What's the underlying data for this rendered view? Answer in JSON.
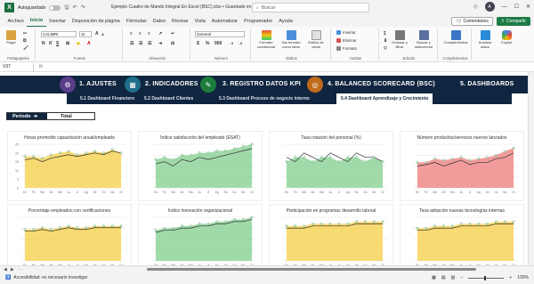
{
  "titlebar": {
    "autosave_label": "Autoguardado",
    "file_title": "Ejemplo Cuadro de Mando Integral En Excel (BSC).xlsx  •  Guardado en…",
    "search_placeholder": "Buscar",
    "avatar_initial": "A"
  },
  "tabs": [
    "Archivo",
    "Inicio",
    "Insertar",
    "Disposición de página",
    "Fórmulas",
    "Datos",
    "Revisar",
    "Vista",
    "Automatizar",
    "Programador",
    "Ayuda"
  ],
  "tab_actions": {
    "comments": "Comentarios",
    "share": "Compartir"
  },
  "ribbon": {
    "paste": "Pegar",
    "font_name": "CALIBRI",
    "font_size": "11",
    "number_format": "General",
    "conditional_format": "Formato condicional",
    "format_table": "Dar formato como tabla",
    "cell_styles": "Estilos de celda",
    "insert": "Insertar",
    "delete": "Eliminar",
    "format": "Formato",
    "sort_filter": "Ordenar y filtrar",
    "find_select": "Buscar y seleccionar",
    "addins": "Complementos",
    "analyze": "Analizar datos",
    "copilot": "Copilot",
    "groups": [
      "Portapapeles",
      "Fuente",
      "Alineación",
      "Número",
      "Estilos",
      "Celdas",
      "Edición",
      "Complementos"
    ]
  },
  "formula": {
    "cell_ref": "V37",
    "fx": "fx"
  },
  "nav": {
    "items": [
      {
        "label": "1. AJUSTES",
        "color": "#5b3d8a",
        "icon": "⚙"
      },
      {
        "label": "2. INDICADORES",
        "color": "#1f6e8c",
        "icon": "▦"
      },
      {
        "label": "3. REGISTRO DATOS KPI",
        "color": "#1c7c3c",
        "icon": "✎"
      },
      {
        "label": "4. BALANCED SCORECARD (BSC)",
        "color": "#c06a1c",
        "icon": "◎"
      },
      {
        "label": "5. DASHBOARDS",
        "color": "#12335a",
        "icon": ""
      }
    ],
    "sub": [
      "5.1 Dashboard Financiero",
      "5.2 Dashboard Clientes",
      "5.3 Dashboard Proceso de negocio interno",
      "5.4 Dashboard Aprendizaje y Crecimiento"
    ]
  },
  "period": {
    "label": "Periodo",
    "arrow": "➔",
    "value": "Total"
  },
  "months": [
    "En",
    "Fe",
    "Ma",
    "Ab",
    "Ma",
    "Ju",
    "Jl",
    "Ag",
    "Se",
    "Oc",
    "No",
    "Di"
  ],
  "chart_data": [
    {
      "type": "area",
      "title": "Horas promedio capacitación anual/empleado",
      "fill": "#f7d35a",
      "ylim": [
        0,
        25
      ],
      "yticks": [
        0,
        5,
        10,
        15,
        20,
        25
      ],
      "series": [
        {
          "values": [
            18,
            18,
            17,
            19,
            20,
            21,
            19,
            20,
            21,
            20,
            22,
            20
          ]
        },
        {
          "values": [
            16,
            17,
            15,
            17,
            18,
            19,
            18,
            19,
            20,
            19,
            21,
            20
          ]
        }
      ]
    },
    {
      "type": "area",
      "title": "Índice satisfacción del empleado (ESAT)",
      "fill": "#8fd39a",
      "ylim": [
        0,
        0.2
      ],
      "yticks": [],
      "series": [
        {
          "values": [
            0.13,
            0.14,
            0.13,
            0.15,
            0.15,
            0.16,
            0.16,
            0.17,
            0.17,
            0.18,
            0.19,
            0.2
          ]
        },
        {
          "values": [
            0.11,
            0.12,
            0.1,
            0.13,
            0.12,
            0.14,
            0.13,
            0.14,
            0.15,
            0.16,
            0.17,
            0.18
          ]
        }
      ]
    },
    {
      "type": "area",
      "title": "Tasa rotación del personal (%)",
      "fill": "#8fd39a",
      "ylim": [
        0,
        10
      ],
      "yticks": [],
      "series": [
        {
          "values": [
            6,
            7,
            7,
            6,
            7,
            7,
            6,
            7,
            7,
            6,
            7,
            6
          ]
        },
        {
          "values": [
            7,
            6,
            8,
            7,
            6,
            8,
            7,
            6,
            8,
            7,
            7,
            6
          ]
        }
      ]
    },
    {
      "type": "area",
      "title": "Número productos/servicios nuevos lanzados",
      "fill": "#f08a8a",
      "ylim": [
        0,
        6
      ],
      "yticks": [],
      "series": [
        {
          "values": [
            3.5,
            3.5,
            4,
            3.8,
            4,
            4.2,
            3.8,
            4,
            4.2,
            4.5,
            5,
            5.5
          ]
        },
        {
          "values": [
            3,
            3.2,
            3.5,
            3,
            3.4,
            3.8,
            3.2,
            3.5,
            3.5,
            4,
            4.2,
            4.8
          ]
        }
      ]
    },
    {
      "type": "area",
      "title": "Porcentaje empleados con certificaciones",
      "fill": "#f7d35a",
      "ylim": [
        0,
        0.25
      ],
      "yticks": [],
      "series": [
        {
          "values": [
            0.18,
            0.18,
            0.19,
            0.18,
            0.19,
            0.2,
            0.19,
            0.19,
            0.2,
            0.2,
            0.2,
            0.2
          ]
        },
        {
          "values": [
            0.17,
            0.17,
            0.18,
            0.17,
            0.18,
            0.19,
            0.18,
            0.18,
            0.19,
            0.19,
            0.19,
            0.19
          ]
        }
      ]
    },
    {
      "type": "area",
      "title": "Índice innovación organizacional",
      "fill": "#8fd39a",
      "ylim": [
        0,
        0.2
      ],
      "yticks": [],
      "series": [
        {
          "values": [
            0.14,
            0.15,
            0.15,
            0.16,
            0.16,
            0.17,
            0.17,
            0.18,
            0.18,
            0.19,
            0.19,
            0.2
          ]
        },
        {
          "values": [
            0.13,
            0.14,
            0.14,
            0.15,
            0.15,
            0.16,
            0.16,
            0.17,
            0.17,
            0.18,
            0.18,
            0.19
          ]
        }
      ]
    },
    {
      "type": "area",
      "title": "Participación en programas desarrollo laboral",
      "fill": "#f7d35a",
      "ylim": [
        0,
        0.2
      ],
      "yticks": [],
      "series": [
        {
          "values": [
            0.16,
            0.16,
            0.16,
            0.17,
            0.17,
            0.17,
            0.17,
            0.17,
            0.18,
            0.18,
            0.18,
            0.18
          ]
        },
        {
          "values": [
            0.15,
            0.15,
            0.15,
            0.16,
            0.16,
            0.16,
            0.16,
            0.16,
            0.17,
            0.17,
            0.17,
            0.17
          ]
        }
      ]
    },
    {
      "type": "area",
      "title": "Tasa adopción nuevas tecnologías internas",
      "fill": "#f7d35a",
      "ylim": [
        0,
        0.2
      ],
      "yticks": [],
      "series": [
        {
          "values": [
            0.15,
            0.15,
            0.16,
            0.16,
            0.16,
            0.17,
            0.17,
            0.17,
            0.17,
            0.18,
            0.18,
            0.18
          ]
        },
        {
          "values": [
            0.14,
            0.14,
            0.15,
            0.15,
            0.15,
            0.16,
            0.16,
            0.16,
            0.16,
            0.17,
            0.17,
            0.17
          ]
        }
      ]
    }
  ],
  "status": {
    "accessibility": "Accesibilidad: es necesario investigar",
    "zoom": "100%"
  }
}
